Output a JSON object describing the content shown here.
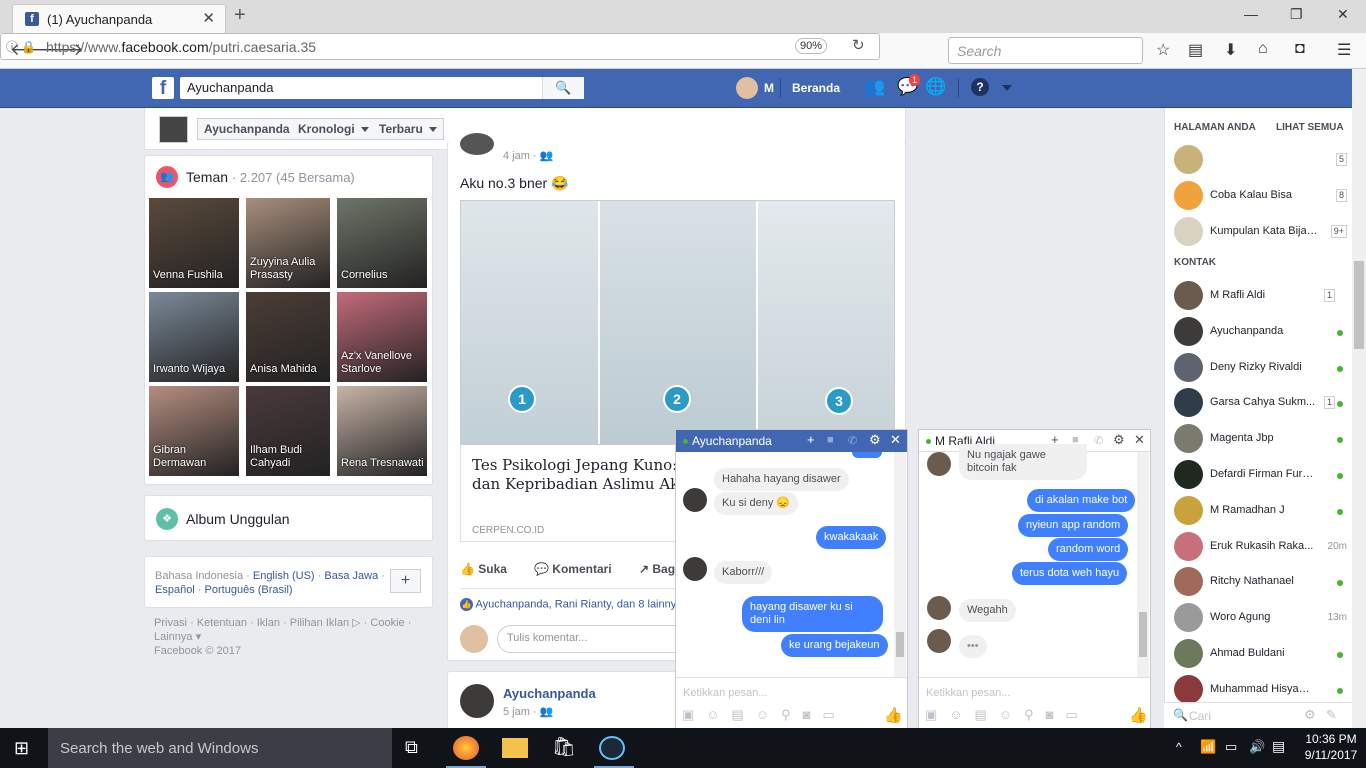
{
  "browser": {
    "tab_title": "(1) Ayuchanpanda",
    "url_prefix": "https://www.",
    "url_domain": "facebook.com",
    "url_path": "/putri.caesaria.35",
    "zoom": "90%",
    "search_placeholder": "Search"
  },
  "fb_header": {
    "search_value": "Ayuchanpanda",
    "user_short": "M",
    "home_label": "Beranda",
    "messenger_badge": "1"
  },
  "timeline_nav": {
    "profile": "Ayuchanpanda",
    "kronologi": "Kronologi",
    "terbaru": "Terbaru"
  },
  "friends": {
    "title": "Teman",
    "count": "· 2.207 (45 Bersama)",
    "items": [
      {
        "name": "Venna Fushila",
        "color": "#5b4a3c"
      },
      {
        "name": "Zuyyina Aulia Prasasty",
        "color": "#a98f7c"
      },
      {
        "name": "Cornelius",
        "color": "#6f7568"
      },
      {
        "name": "Irwanto Wijaya",
        "color": "#7b8a99"
      },
      {
        "name": "Anisa Mahida",
        "color": "#4c3e36"
      },
      {
        "name": "Az'x Vanellove Starlove",
        "color": "#c46a7a"
      },
      {
        "name": "Gibran Dermawan",
        "color": "#b58e80"
      },
      {
        "name": "Ilham Budi Cahyadi",
        "color": "#4a3a3c"
      },
      {
        "name": "Rena Tresnawati",
        "color": "#c8b4a6"
      }
    ]
  },
  "album": {
    "title": "Album Unggulan"
  },
  "languages": {
    "current": "Bahasa Indonesia",
    "links": [
      "English (US)",
      "Basa Jawa",
      "Español",
      "Português (Brasil)"
    ]
  },
  "footer": {
    "links": [
      "Privasi",
      "Ketentuan",
      "Iklan",
      "Pilihan Iklan",
      "Cookie",
      "Lainnya"
    ],
    "copyright": "Facebook © 2017"
  },
  "post": {
    "time": "4 jam ·",
    "text": "Aku no.3 bner 😂",
    "image_numbers": [
      "1",
      "2",
      "3"
    ],
    "link_title": "Tes Psikologi Jepang Kuno: \"Kepalkan Tanganmu\", dan Kepribadian Aslimu Akan Terkuak!",
    "link_source": "CERPEN.CO.ID",
    "actions": [
      "Suka",
      "Komentari",
      "Bagikan"
    ],
    "likes": "Ayuchanpanda, Rani Rianty, dan 8 lainnya",
    "comment_placeholder": "Tulis komentar..."
  },
  "post2": {
    "name": "Ayuchanpanda",
    "time": "5 jam ·"
  },
  "chat1": {
    "name": "Ayuchanpanda",
    "input_placeholder": "Ketikkan pesan...",
    "messages": [
      {
        "text": "Hahaha hayang disawer",
        "dir": "in"
      },
      {
        "text": "Ku si deny 😞",
        "dir": "in"
      },
      {
        "text": "kwakakaak",
        "dir": "out"
      },
      {
        "text": "Kaborr///",
        "dir": "in"
      },
      {
        "text": "hayang disawer ku si deni lin",
        "dir": "out"
      },
      {
        "text": "ke urang bejakeun",
        "dir": "out"
      }
    ]
  },
  "chat2": {
    "name": "M Rafli Aldi",
    "input_placeholder": "Ketikkan pesan...",
    "messages": [
      {
        "text": "Nu ngajak gawe bitcoin fak",
        "dir": "in"
      },
      {
        "text": "di akalan make bot",
        "dir": "out"
      },
      {
        "text": "nyieun app  random",
        "dir": "out"
      },
      {
        "text": "random word",
        "dir": "out"
      },
      {
        "text": "terus dota weh hayu",
        "dir": "out"
      },
      {
        "text": "Wegahh",
        "dir": "in"
      },
      {
        "text": "•••",
        "dir": "in"
      }
    ]
  },
  "sidebar": {
    "pages_header": "HALAMAN ANDA",
    "see_all": "LIHAT SEMUA",
    "pages": [
      {
        "name": "",
        "badge": "5",
        "color": "#c9b27a"
      },
      {
        "name": "Coba Kalau Bisa",
        "badge": "8",
        "color": "#f2a23a"
      },
      {
        "name": "Kumpulan Kata Bijak ...",
        "badge": "9+",
        "color": "#d9d2c0"
      }
    ],
    "contacts_header": "KONTAK",
    "contacts": [
      {
        "name": "M Rafli Aldi",
        "badge": "1",
        "status": "",
        "color": "#6b5a4e"
      },
      {
        "name": "Ayuchanpanda",
        "badge": "",
        "status": "online",
        "color": "#3d3a3a"
      },
      {
        "name": "Deny Rizky Rivaldi",
        "badge": "",
        "status": "online",
        "color": "#5d6470"
      },
      {
        "name": "Garsa Cahya Sukm...",
        "badge": "1",
        "status": "online",
        "color": "#2f3c4a"
      },
      {
        "name": "Magenta Jbp",
        "badge": "",
        "status": "online",
        "color": "#7a7a6e"
      },
      {
        "name": "Defardi Firman Furyu...",
        "badge": "",
        "status": "online",
        "color": "#1f2a1f"
      },
      {
        "name": "M Ramadhan J",
        "badge": "",
        "status": "online",
        "color": "#c9a23c"
      },
      {
        "name": "Eruk Rukasih Raka...",
        "badge": "",
        "status": "20m",
        "color": "#c8707a"
      },
      {
        "name": "Ritchy Nathanael",
        "badge": "",
        "status": "online",
        "color": "#a06a5a"
      },
      {
        "name": "Woro Agung",
        "badge": "",
        "status": "13m",
        "color": "#9a9a9a"
      },
      {
        "name": "Ahmad Buldani",
        "badge": "",
        "status": "online",
        "color": "#6a7a5a"
      },
      {
        "name": "Muhammad Hisyam F...",
        "badge": "",
        "status": "online",
        "color": "#8a3a3a"
      }
    ],
    "search_placeholder": "Cari"
  },
  "taskbar": {
    "search_placeholder": "Search the web and Windows",
    "time": "10:36 PM",
    "date": "9/11/2017"
  }
}
